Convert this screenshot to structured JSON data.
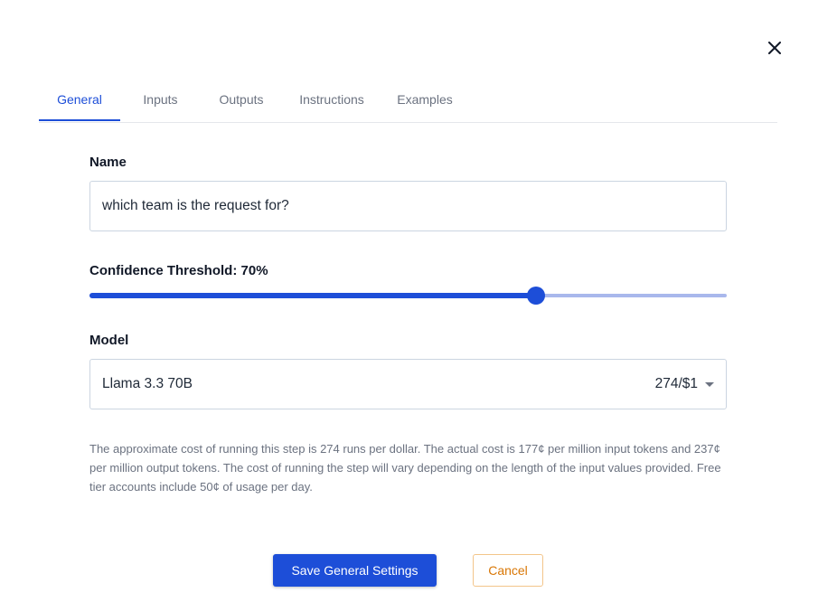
{
  "dialog": {
    "close_icon": "close-icon"
  },
  "tabs": [
    {
      "label": "General",
      "active": true
    },
    {
      "label": "Inputs",
      "active": false
    },
    {
      "label": "Outputs",
      "active": false
    },
    {
      "label": "Instructions",
      "active": false
    },
    {
      "label": "Examples",
      "active": false
    }
  ],
  "form": {
    "name_label": "Name",
    "name_value": "which team is the request for?",
    "confidence_label": "Confidence Threshold: 70%",
    "confidence_value": 0.7,
    "model_label": "Model",
    "model_name": "Llama 3.3 70B",
    "model_rate": "274/$1",
    "description": "The approximate cost of running this step is 274 runs per dollar. The actual cost is 177¢ per million input tokens and 237¢ per million output tokens. The cost of running the step will vary depending on the length of the input values provided. Free tier accounts include 50¢ of usage per day."
  },
  "actions": {
    "save_label": "Save General Settings",
    "cancel_label": "Cancel"
  },
  "colors": {
    "primary": "#1d4ed8",
    "cancel": "#d97706"
  }
}
